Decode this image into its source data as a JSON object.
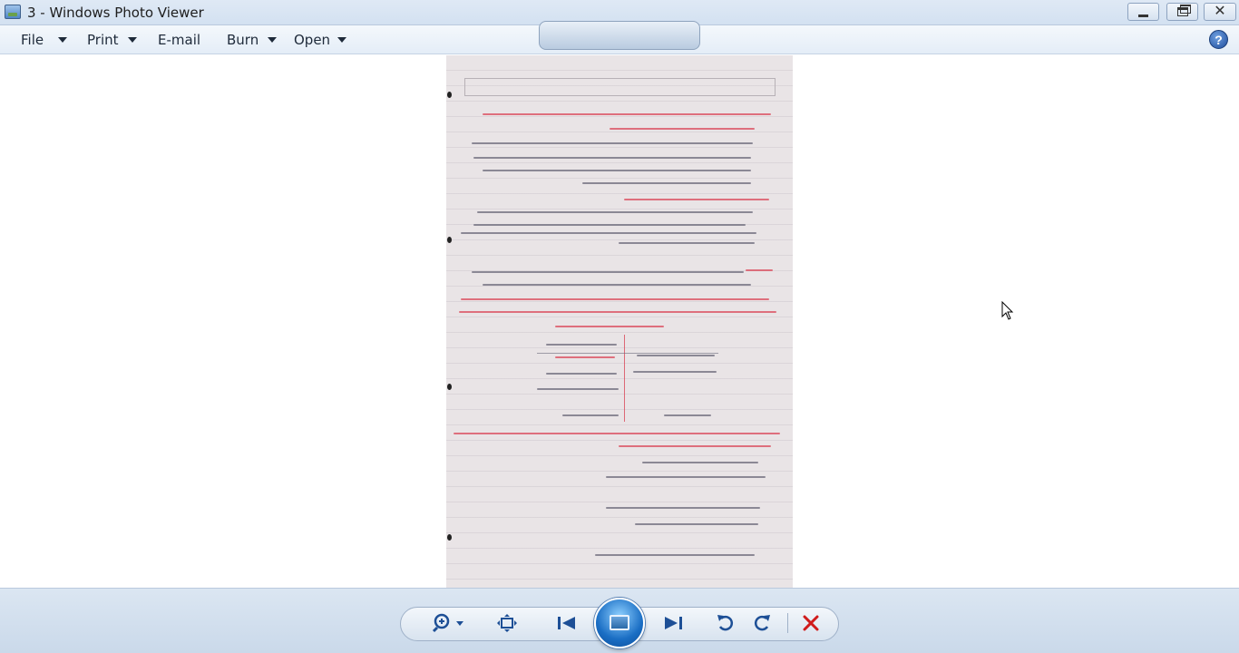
{
  "window": {
    "title": "3 - Windows Photo Viewer"
  },
  "menu": {
    "file": "File",
    "print": "Print",
    "email": "E-mail",
    "burn": "Burn",
    "open": "Open"
  },
  "help": {
    "glyph": "?"
  },
  "icons": {
    "app": "photo-viewer-icon",
    "minimize": "minimize-icon",
    "maximize": "restore-icon",
    "close": "close-icon",
    "help": "help-icon",
    "zoom": "zoom-icon",
    "actual_size": "actual-size-icon",
    "previous": "previous-icon",
    "slideshow": "slideshow-icon",
    "next": "next-icon",
    "rotate_ccw": "rotate-counterclockwise-icon",
    "rotate_cw": "rotate-clockwise-icon",
    "delete": "delete-icon"
  },
  "colors": {
    "titlebar": "#d3e1f1",
    "controlbar": "#cad9ea",
    "accent": "#1a6ec4",
    "delete": "#d01c1c"
  }
}
